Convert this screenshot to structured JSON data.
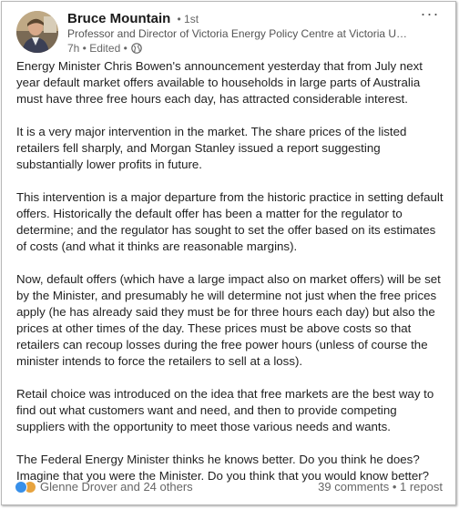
{
  "author": {
    "name": "Bruce Mountain",
    "degree": "• 1st",
    "headline": "Professor and Director of Victoria Energy Policy Centre at Victoria University: ...",
    "time": "7h • Edited •"
  },
  "menu": {
    "more_label": "···"
  },
  "post": {
    "p1": "Energy Minister Chris Bowen's announcement yesterday that from July next year default market offers available to households in large parts of Australia must have three free hours each day, has attracted considerable interest.",
    "p2": "It is a very major intervention in the market. The share prices of the listed retailers fell sharply, and Morgan Stanley issued a report suggesting substantially lower profits in future.",
    "p3": "This intervention is a major departure from the historic practice in setting default offers. Historically the default offer has been a matter for the regulator to determine; and the regulator has sought to set the offer based on its estimates of costs (and what it thinks are reasonable margins).",
    "p4": "Now, default offers (which have a large impact also on market offers) will be set by the Minister, and presumably he will determine not just when the free prices apply (he has already said they must be for three hours each day) but also the prices at other times of the day. These prices must be above costs so that retailers can recoup losses during the free power hours (unless of course the minister intends to force the retailers to sell at a loss).",
    "p5": "Retail choice was introduced on the idea that free markets are the best way to find out what customers want and need, and then to provide competing suppliers with the opportunity to meet those various needs and wants.",
    "p6": "The Federal Energy Minister thinks he knows better. Do you think he does? Imagine that you were the Minister. Do you think that you would know better?"
  },
  "footer": {
    "reactors": "Glenne Drover and 24 others",
    "comments": "39 comments",
    "separator": "•",
    "reposts": "1 repost"
  },
  "colors": {
    "like": "#378fe9",
    "support": "#e7a33e",
    "name": "#1a1a1a",
    "muted": "#666666"
  },
  "icons": {
    "privacy": "globe-icon",
    "like": "like-reaction-icon",
    "support": "support-reaction-icon"
  }
}
